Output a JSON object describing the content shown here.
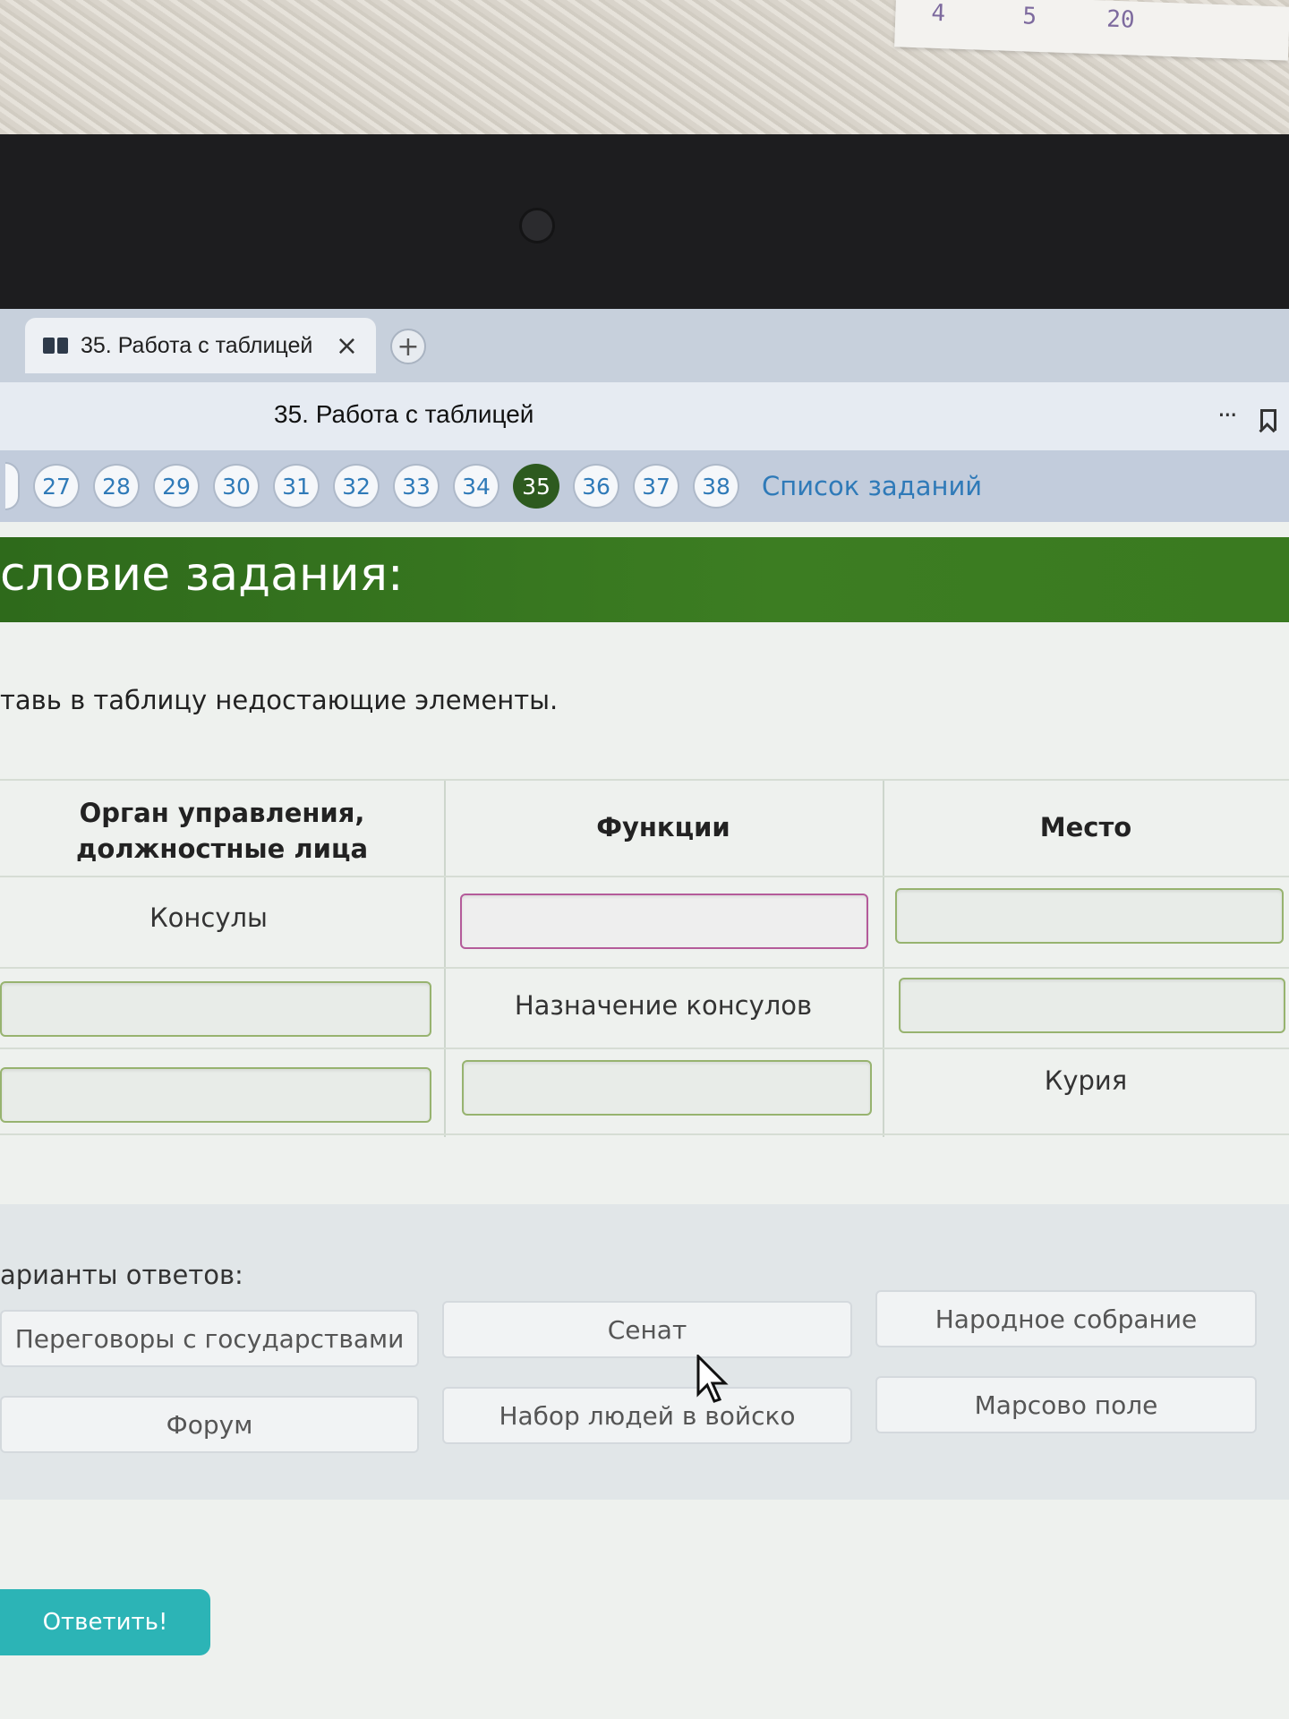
{
  "browser": {
    "tab_title": "35. Работа с таблицей",
    "tab_close": "×",
    "new_tab": "+",
    "page_title": "35. Работа с таблицей",
    "more_menu": "···"
  },
  "task_nav": {
    "numbers": [
      "27",
      "28",
      "29",
      "30",
      "31",
      "32",
      "33",
      "34",
      "35",
      "36",
      "37",
      "38"
    ],
    "active": "35",
    "list_link": "Список заданий"
  },
  "condition": {
    "header": "словие задания:",
    "instruction": "тавь в таблицу недостающие элементы."
  },
  "table": {
    "headers": [
      "Орган управления, должностные лица",
      "Функции",
      "Место"
    ],
    "header_lines": [
      "Орган управления,",
      "должностные лица"
    ],
    "rows": [
      {
        "organ": "Консулы",
        "function": "",
        "place": ""
      },
      {
        "organ": "",
        "function": "Назначение консулов",
        "place": ""
      },
      {
        "organ": "",
        "function": "",
        "place": "Курия"
      }
    ]
  },
  "answers": {
    "label": "арианты ответов:",
    "options": [
      "Переговоры с государствами",
      "Сенат",
      "Народное собрание",
      "Форум",
      "Набор людей в войско",
      "Марсово поле"
    ]
  },
  "submit_label": "Ответить!",
  "sticky_marks": [
    "4",
    "5",
    "20"
  ],
  "colors": {
    "header_green": "#2e6a1b",
    "active_number": "#2d5a1f",
    "link_blue": "#2f7ab8",
    "submit": "#2cb4b6"
  }
}
